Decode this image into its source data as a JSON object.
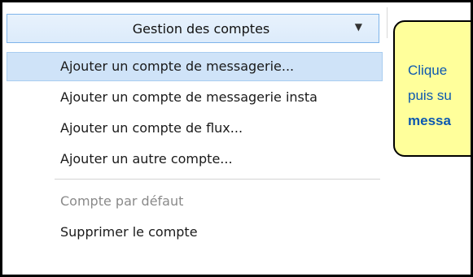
{
  "dropdown": {
    "label": "Gestion des comptes",
    "arrow_icon": "triangle-down-icon"
  },
  "menu": {
    "items": [
      {
        "label": "Ajouter un compte de messagerie...",
        "state": "highlighted"
      },
      {
        "label": "Ajouter un compte de messagerie insta",
        "state": "normal"
      },
      {
        "label": "Ajouter un compte de flux...",
        "state": "normal"
      },
      {
        "label": "Ajouter un autre compte...",
        "state": "normal"
      },
      {
        "label": "Compte par défaut",
        "state": "disabled"
      },
      {
        "label": "Supprimer le compte",
        "state": "normal"
      }
    ]
  },
  "callout": {
    "line1": "Clique",
    "line2": "puis su",
    "line3": "messa"
  },
  "colors": {
    "highlight": "#cfe3f8",
    "callout_bg": "#ffff9b",
    "callout_text": "#0c58b0"
  }
}
